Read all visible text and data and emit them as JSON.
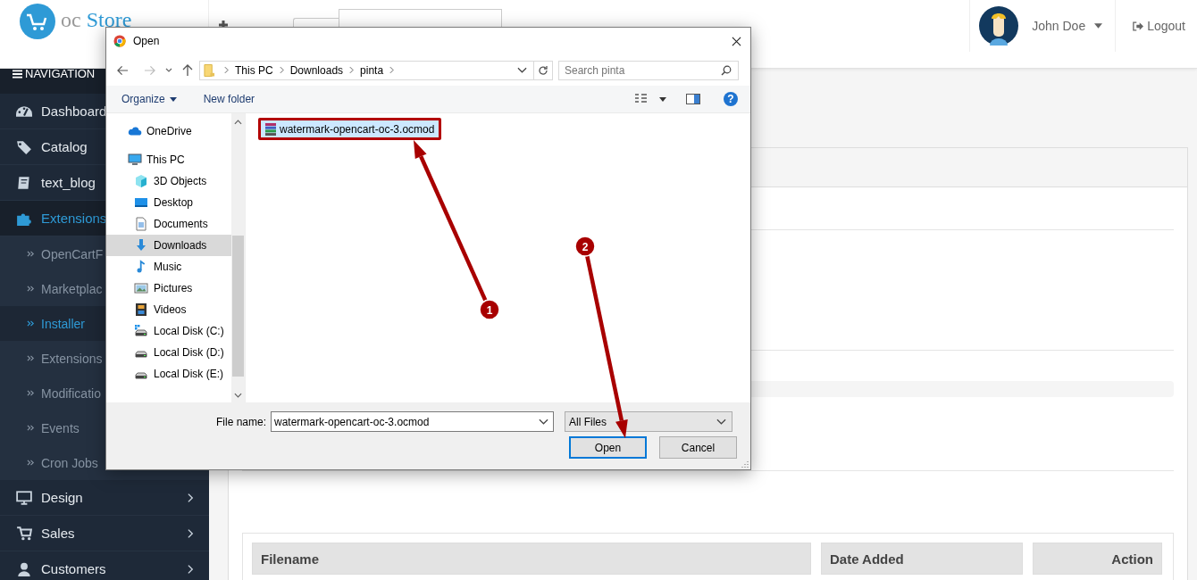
{
  "header": {
    "logo": {
      "prefix": "oc",
      "name": "Store"
    },
    "user": {
      "name": "John Doe"
    },
    "logout": "Logout"
  },
  "sidebar": {
    "title": "NAVIGATION",
    "items": [
      {
        "label": "Dashboard",
        "kind": "link",
        "selected": false
      },
      {
        "label": "Catalog",
        "kind": "link",
        "selected": false
      },
      {
        "label": "text_blog",
        "kind": "link",
        "selected": false
      },
      {
        "label": "Extensions",
        "kind": "link",
        "selected": true,
        "children": [
          {
            "label": "OpenCartF",
            "selected": false
          },
          {
            "label": "Marketplac",
            "selected": false
          },
          {
            "label": "Installer",
            "selected": true
          },
          {
            "label": "Extensions",
            "selected": false
          },
          {
            "label": "Modificatio",
            "selected": false
          },
          {
            "label": "Events",
            "selected": false
          },
          {
            "label": "Cron Jobs",
            "selected": false
          }
        ]
      },
      {
        "label": "Design",
        "kind": "menu",
        "selected": false
      },
      {
        "label": "Sales",
        "kind": "menu",
        "selected": false
      },
      {
        "label": "Customers",
        "kind": "menu",
        "selected": false
      }
    ]
  },
  "content": {
    "progress": {
      "level": 0
    },
    "table": {
      "columns": [
        "Filename",
        "Date Added",
        "Action"
      ]
    }
  },
  "dialog": {
    "title": "Open",
    "breadcrumbs": [
      "This PC",
      "Downloads",
      "pinta"
    ],
    "search": {
      "placeholder": "Search pinta"
    },
    "toolbar": {
      "organize": "Organize",
      "new_folder": "New folder",
      "help": "?"
    },
    "nav_tree": [
      {
        "label": "OneDrive",
        "selected": false
      },
      {
        "label": "This PC",
        "selected": false,
        "children": [
          {
            "label": "3D Objects",
            "selected": false
          },
          {
            "label": "Desktop",
            "selected": false
          },
          {
            "label": "Documents",
            "selected": false
          },
          {
            "label": "Downloads",
            "selected": true
          },
          {
            "label": "Music",
            "selected": false
          },
          {
            "label": "Pictures",
            "selected": false
          },
          {
            "label": "Videos",
            "selected": false
          },
          {
            "label": "Local Disk (C:)",
            "selected": false
          },
          {
            "label": "Local Disk (D:)",
            "selected": false
          },
          {
            "label": "Local Disk (E:)",
            "selected": false
          }
        ]
      }
    ],
    "files": [
      {
        "name": "watermark-opencart-oc-3.ocmod",
        "selected": true
      }
    ],
    "file_name": {
      "label": "File name:",
      "value": "watermark-opencart-oc-3.ocmod"
    },
    "file_type": "All Files",
    "buttons": [
      {
        "label": "Open",
        "default": true
      },
      {
        "label": "Cancel",
        "default": false
      }
    ]
  },
  "annotations": [
    {
      "number": "1"
    },
    {
      "number": "2"
    }
  ]
}
